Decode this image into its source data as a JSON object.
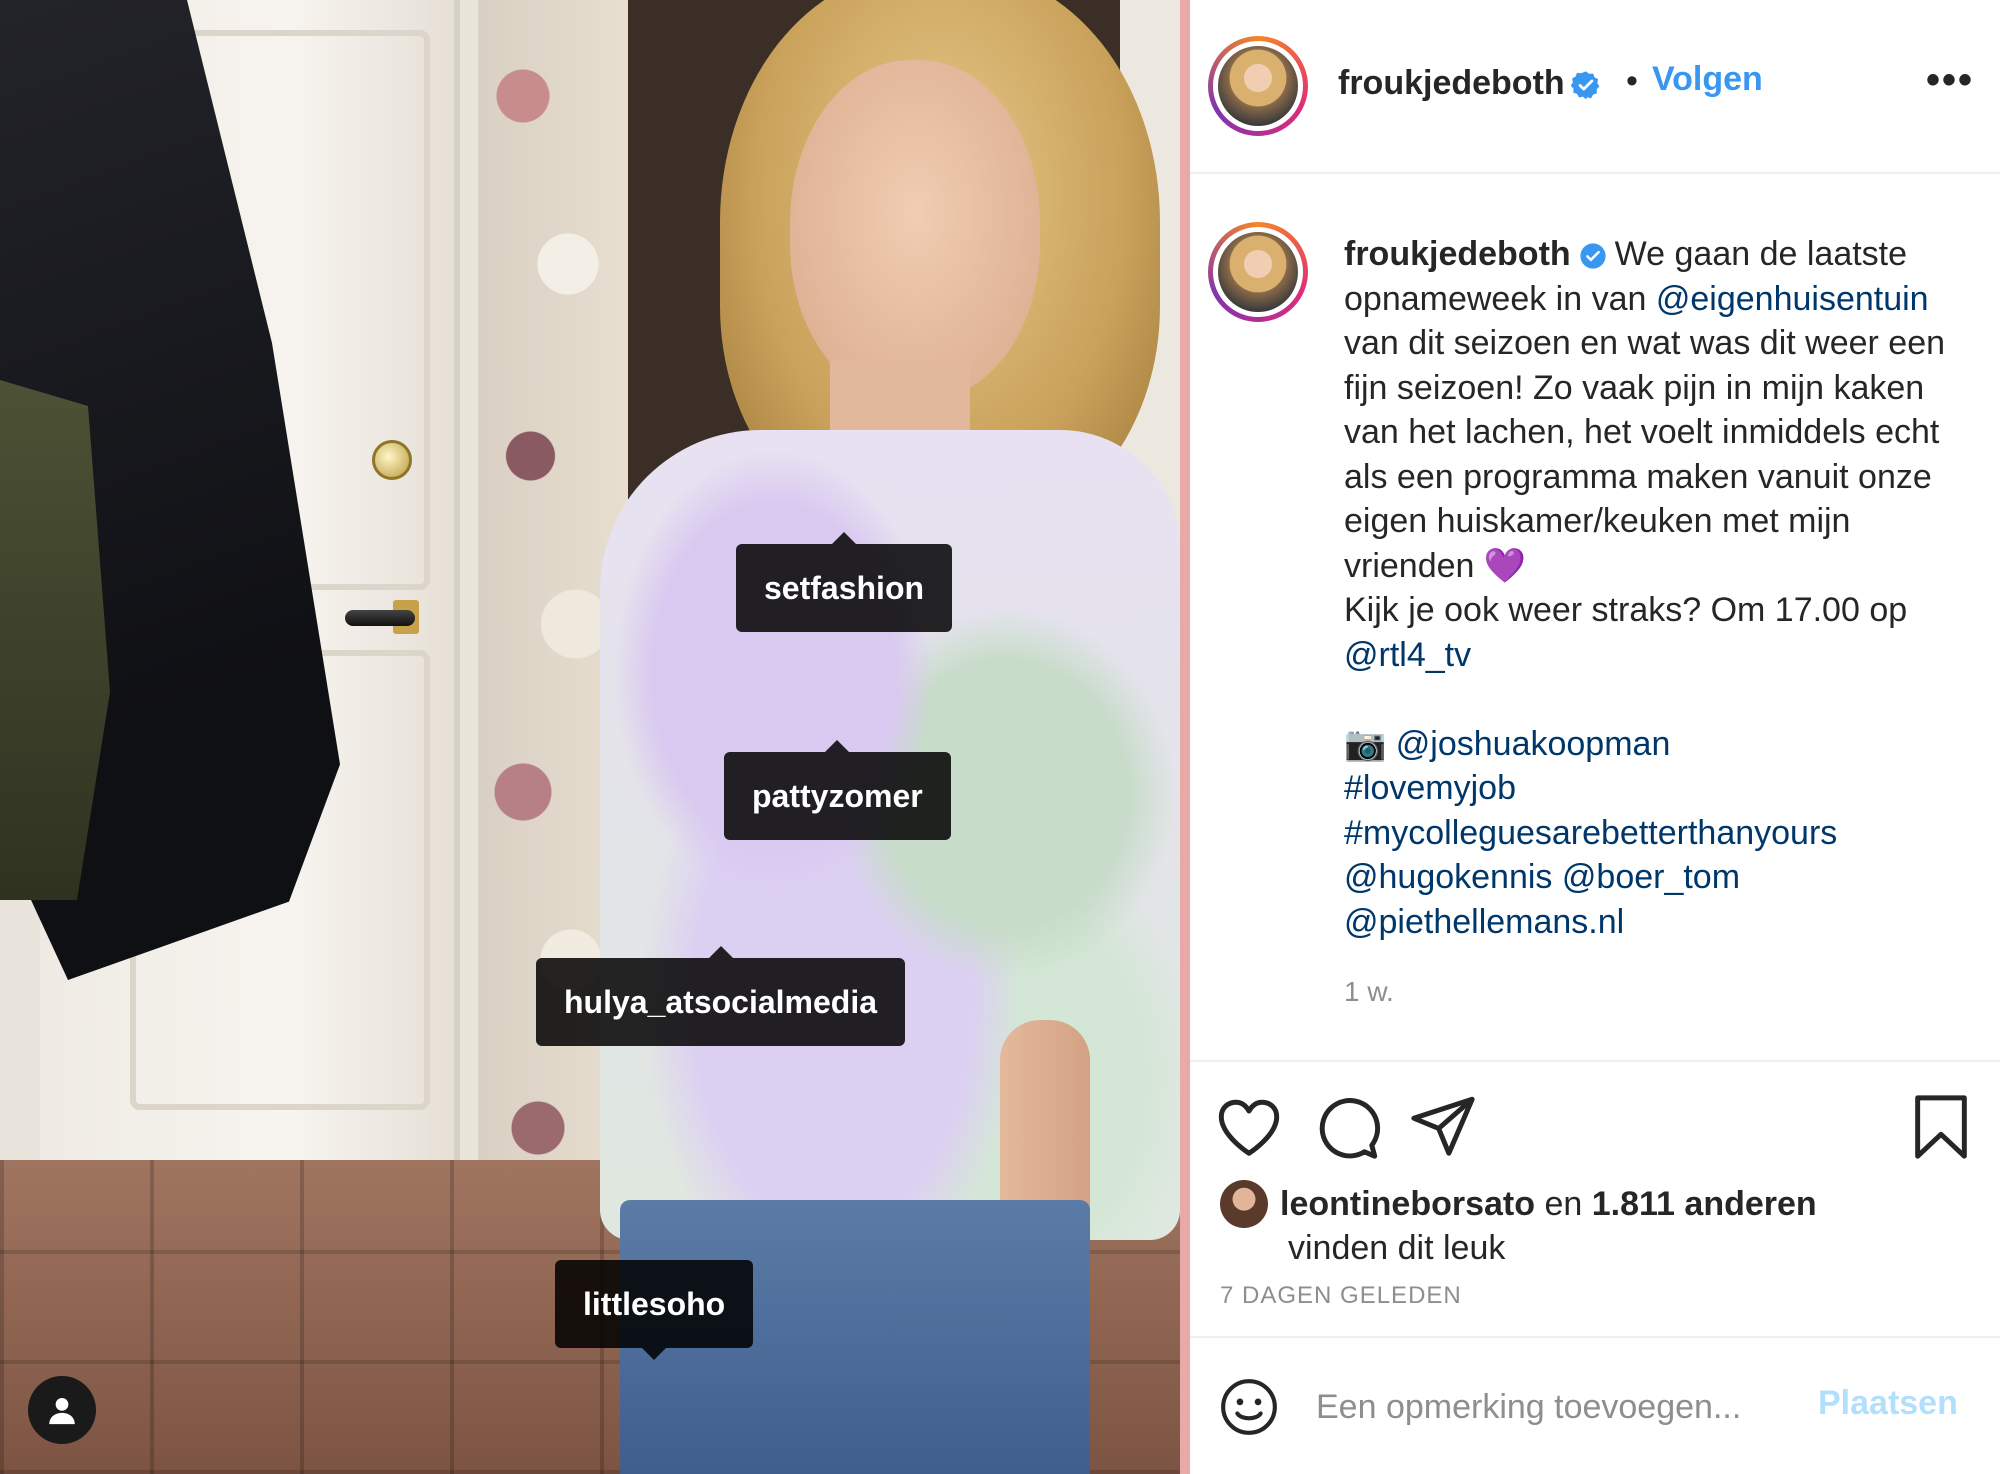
{
  "colors": {
    "accent_blue": "#3897f0",
    "link_blue": "#00376b",
    "muted_gray": "#8e8e8e",
    "post_disabled": "#b2dffc"
  },
  "photo": {
    "tags": [
      "setfashion",
      "pattyzomer",
      "hulya_atsocialmedia",
      "littlesoho"
    ],
    "user_tags_icon": "person-icon"
  },
  "header": {
    "username": "froukjedeboth",
    "verified_icon": "verified-badge-icon",
    "separator": "•",
    "follow_label": "Volgen",
    "more_label": "•••"
  },
  "caption": {
    "username": "froukjedeboth",
    "lines": [
      {
        "parts": [
          {
            "text": "We gaan de laatste"
          }
        ]
      },
      {
        "parts": [
          {
            "text": "opnameweek in van "
          },
          {
            "text": "@eigenhuisentuin",
            "link": true
          }
        ]
      },
      {
        "parts": [
          {
            "text": "van dit seizoen en wat was dit weer een"
          }
        ]
      },
      {
        "parts": [
          {
            "text": "fijn seizoen! Zo vaak pijn in mijn kaken"
          }
        ]
      },
      {
        "parts": [
          {
            "text": "van het lachen, het voelt inmiddels echt"
          }
        ]
      },
      {
        "parts": [
          {
            "text": "als een programma maken vanuit onze"
          }
        ]
      },
      {
        "parts": [
          {
            "text": "eigen huiskamer/keuken met mijn"
          }
        ]
      },
      {
        "parts": [
          {
            "text": "vrienden 💜"
          }
        ]
      },
      {
        "parts": [
          {
            "text": "Kijk je ook weer straks? Om 17.00 op"
          }
        ]
      },
      {
        "parts": [
          {
            "text": "@rtl4_tv",
            "link": true
          }
        ]
      },
      {
        "blank": true
      },
      {
        "parts": [
          {
            "text": "📷 "
          },
          {
            "text": "@joshuakoopman",
            "link": true
          }
        ]
      },
      {
        "parts": [
          {
            "text": "#lovemyjob",
            "link": true
          }
        ]
      },
      {
        "parts": [
          {
            "text": "#mycolleguesarebetterthanyours",
            "link": true
          }
        ]
      },
      {
        "parts": [
          {
            "text": "@hugokennis",
            "link": true
          },
          {
            "text": " "
          },
          {
            "text": "@boer_tom",
            "link": true
          }
        ]
      },
      {
        "parts": [
          {
            "text": "@piethellemans.nl",
            "link": true
          }
        ]
      }
    ],
    "time": "1 w."
  },
  "actions": {
    "icons": [
      "heart-icon",
      "comment-icon",
      "share-icon",
      "bookmark-icon"
    ],
    "liked_by_user": "leontineborsato",
    "liked_by_connector": " en ",
    "liked_by_others": "1.811 anderen",
    "liked_by_suffix": "vinden dit leuk",
    "date": "7 DAGEN GELEDEN"
  },
  "comment": {
    "emoji_icon": "smiley-icon",
    "placeholder": "Een opmerking toevoegen...",
    "post_label": "Plaatsen"
  }
}
